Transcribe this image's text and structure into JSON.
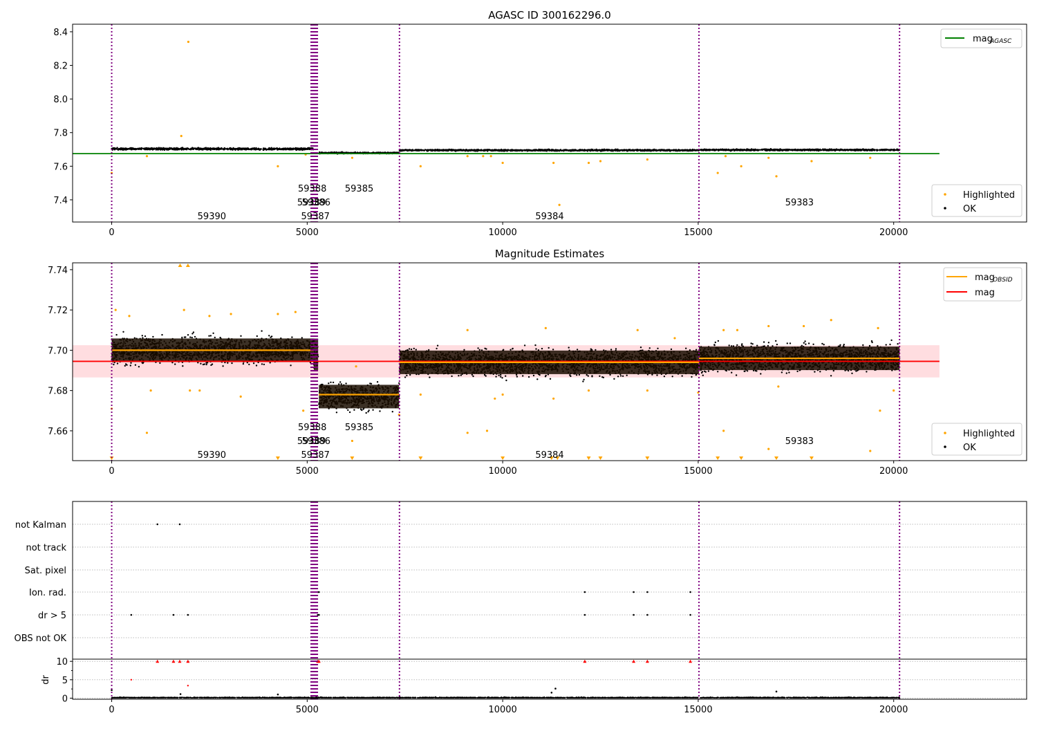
{
  "chart_data": [
    {
      "type": "scatter",
      "title": "AGASC ID 300162296.0",
      "xlim": [
        -1000,
        23400
      ],
      "ylim": [
        7.268,
        8.445
      ],
      "xticks": [
        0,
        5000,
        10000,
        15000,
        20000
      ],
      "yticks": [
        7.4,
        7.6,
        7.8,
        8.0,
        8.2,
        8.4
      ],
      "ytick_labels": [
        "7.4",
        "7.6",
        "7.8",
        "8.0",
        "8.2",
        "8.4"
      ],
      "reference_line": {
        "name": "mag_AGASC",
        "label": "mag",
        "sub": "AGASC",
        "value": 7.675,
        "x_range": [
          -1000,
          21170
        ],
        "color": "#008000"
      },
      "ok_segments": [
        {
          "x_range": [
            0,
            5170
          ],
          "center": 7.703,
          "spread": 0.004
        },
        {
          "x_range": [
            5300,
            7350
          ],
          "center": 7.679,
          "spread": 0.003
        },
        {
          "x_range": [
            7360,
            15020
          ],
          "center": 7.695,
          "spread": 0.003
        },
        {
          "x_range": [
            15020,
            20150
          ],
          "center": 7.697,
          "spread": 0.003
        }
      ],
      "highlighted": [
        [
          0,
          7.56
        ],
        [
          900,
          7.66
        ],
        [
          1780,
          7.78
        ],
        [
          1960,
          8.34
        ],
        [
          4250,
          7.6
        ],
        [
          4960,
          7.67
        ],
        [
          6150,
          7.65
        ],
        [
          7900,
          7.6
        ],
        [
          9100,
          7.66
        ],
        [
          9500,
          7.66
        ],
        [
          9700,
          7.66
        ],
        [
          10000,
          7.62
        ],
        [
          11300,
          7.62
        ],
        [
          11450,
          7.37
        ],
        [
          12200,
          7.62
        ],
        [
          12500,
          7.63
        ],
        [
          13700,
          7.64
        ],
        [
          15500,
          7.56
        ],
        [
          15700,
          7.66
        ],
        [
          16100,
          7.6
        ],
        [
          16800,
          7.65
        ],
        [
          17000,
          7.54
        ],
        [
          17900,
          7.63
        ],
        [
          19400,
          7.65
        ]
      ],
      "legend": {
        "placement": "lower-right",
        "entries": [
          "Highlighted",
          "OK"
        ]
      },
      "obsid_labels": [
        {
          "text": "59390",
          "x": 2560
        },
        {
          "text": "59388",
          "x": 5130
        },
        {
          "text": "59385",
          "x": 6330
        },
        {
          "text": "59389",
          "x": 5110
        },
        {
          "text": "59386",
          "x": 5230
        },
        {
          "text": "59387",
          "x": 5210
        },
        {
          "text": "59384",
          "x": 11200
        },
        {
          "text": "59383",
          "x": 17590
        }
      ],
      "obsid_boundaries": [
        0,
        5100,
        5120,
        5140,
        5160,
        5180,
        5200,
        5220,
        5240,
        5260,
        7360,
        15020,
        20150
      ]
    },
    {
      "type": "scatter",
      "title": "Magnitude Estimates",
      "xlim": [
        -1000,
        23400
      ],
      "ylim": [
        7.6452,
        7.7434
      ],
      "xticks": [
        0,
        5000,
        10000,
        15000,
        20000
      ],
      "yticks": [
        7.66,
        7.68,
        7.7,
        7.72,
        7.74
      ],
      "ytick_labels": [
        "7.66",
        "7.68",
        "7.70",
        "7.72",
        "7.74"
      ],
      "mag": {
        "value": 7.6945,
        "band": [
          7.6865,
          7.7025
        ],
        "x_range": [
          -1000,
          21170
        ],
        "color": "#ff0000",
        "band_color": "#ffdde0"
      },
      "mag_obsid": [
        {
          "x_range": [
            0,
            5170
          ],
          "value": 7.7
        },
        {
          "x_range": [
            5300,
            7350
          ],
          "value": 7.678
        },
        {
          "x_range": [
            7360,
            15020
          ],
          "value": 7.694
        },
        {
          "x_range": [
            15020,
            20150
          ],
          "value": 7.696
        }
      ],
      "ok_segments": [
        {
          "x_range": [
            0,
            5170
          ],
          "center": 7.7,
          "spread": 0.0045
        },
        {
          "x_range": [
            5170,
            5280
          ],
          "center": 7.698,
          "spread": 0.006
        },
        {
          "x_range": [
            5300,
            7350
          ],
          "center": 7.677,
          "spread": 0.0045
        },
        {
          "x_range": [
            7360,
            15020
          ],
          "center": 7.694,
          "spread": 0.0045
        },
        {
          "x_range": [
            15020,
            20150
          ],
          "center": 7.696,
          "spread": 0.0045
        }
      ],
      "highlighted": [
        [
          0,
          7.671
        ],
        [
          100,
          7.72
        ],
        [
          450,
          7.717
        ],
        [
          900,
          7.659
        ],
        [
          1000,
          7.68
        ],
        [
          1850,
          7.72
        ],
        [
          2000,
          7.68
        ],
        [
          2250,
          7.68
        ],
        [
          2500,
          7.717
        ],
        [
          3050,
          7.718
        ],
        [
          3300,
          7.677
        ],
        [
          4250,
          7.718
        ],
        [
          4700,
          7.719
        ],
        [
          4900,
          7.67
        ],
        [
          6150,
          7.655
        ],
        [
          6250,
          7.692
        ],
        [
          7350,
          7.668
        ],
        [
          7900,
          7.678
        ],
        [
          9100,
          7.71
        ],
        [
          9100,
          7.659
        ],
        [
          9600,
          7.66
        ],
        [
          9800,
          7.676
        ],
        [
          10000,
          7.678
        ],
        [
          11100,
          7.711
        ],
        [
          11300,
          7.676
        ],
        [
          12200,
          7.68
        ],
        [
          13450,
          7.71
        ],
        [
          13700,
          7.68
        ],
        [
          14400,
          7.706
        ],
        [
          15000,
          7.679
        ],
        [
          15650,
          7.66
        ],
        [
          15650,
          7.71
        ],
        [
          16000,
          7.71
        ],
        [
          16800,
          7.651
        ],
        [
          16800,
          7.712
        ],
        [
          17050,
          7.682
        ],
        [
          17700,
          7.712
        ],
        [
          18400,
          7.715
        ],
        [
          19400,
          7.65
        ],
        [
          19600,
          7.711
        ],
        [
          19650,
          7.67
        ],
        [
          20000,
          7.68
        ]
      ],
      "out_of_range_below": [
        0,
        4250,
        6150,
        7900,
        10000,
        11250,
        11400,
        12200,
        12500,
        13700,
        15500,
        16100,
        17000,
        17900
      ],
      "out_of_range_above": [
        1750,
        1950
      ],
      "legend_top": {
        "placement": "upper-right",
        "entries": [
          {
            "label": "mag",
            "sub": "OBSID",
            "color": "#ffa500"
          },
          {
            "label": "mag",
            "sub": "",
            "color": "#ff0000"
          }
        ]
      },
      "legend": {
        "placement": "lower-right",
        "entries": [
          "Highlighted",
          "OK"
        ]
      }
    },
    {
      "type": "scatter",
      "title": "",
      "xlim": [
        -1000,
        23400
      ],
      "xticks": [
        0,
        5000,
        10000,
        15000,
        20000
      ],
      "flag_rows": [
        "not Kalman",
        "not track",
        "Sat. pixel",
        "Ion. rad.",
        "dr > 5",
        "OBS not OK"
      ],
      "flags": {
        "not Kalman": [
          1170,
          1740
        ],
        "not track": [],
        "Sat. pixel": [],
        "Ion. rad.": [
          5270,
          5300,
          12100,
          13350,
          13700,
          14800
        ],
        "dr > 5": [
          500,
          1580,
          1950,
          5270,
          5300,
          12100,
          13350,
          13700,
          14800
        ],
        "OBS not OK": []
      },
      "dr": {
        "ylabel": "dr",
        "ylim": [
          -0.3,
          10.6
        ],
        "yticks": [
          0,
          5,
          10
        ],
        "ytick_labels": [
          "0",
          "5",
          "10"
        ],
        "typical": 0.2,
        "clipped_at_10": [
          1170,
          1580,
          1740,
          1950,
          5270,
          5300,
          12100,
          13350,
          13700,
          14800
        ],
        "highlighted": [
          [
            500,
            5.0
          ],
          [
            1950,
            3.4
          ]
        ],
        "notable": [
          [
            0,
            2.2
          ],
          [
            4250,
            1.0
          ],
          [
            11250,
            1.5
          ],
          [
            11350,
            2.6
          ],
          [
            17000,
            1.8
          ],
          [
            1760,
            1.1
          ]
        ]
      }
    }
  ]
}
